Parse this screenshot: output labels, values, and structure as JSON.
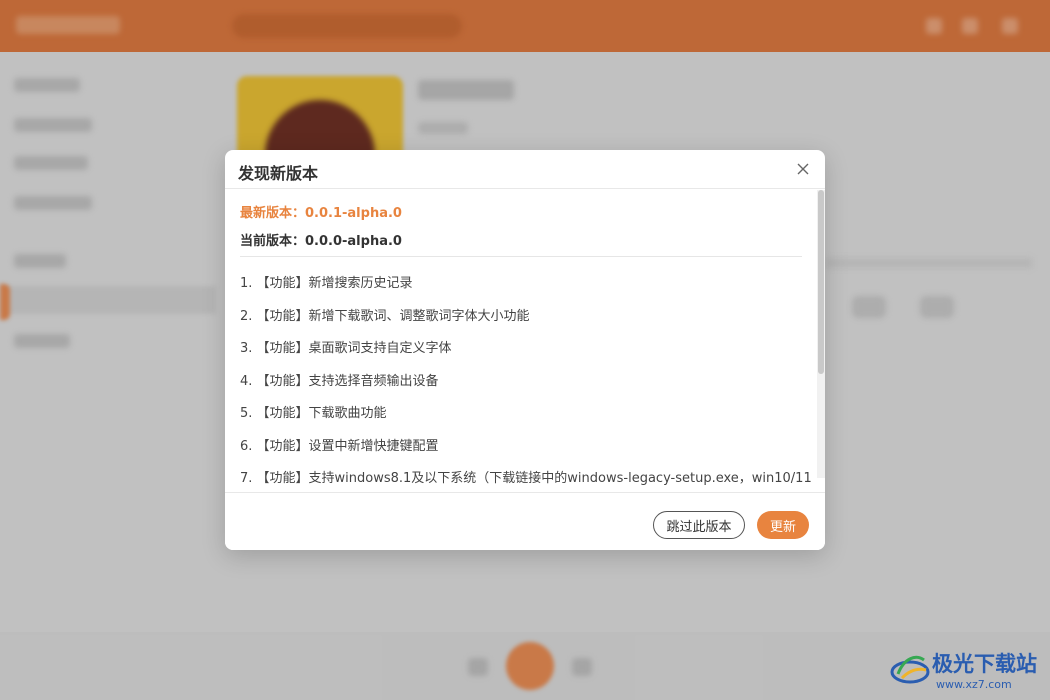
{
  "dialog": {
    "title": "发现新版本",
    "latest_version": "最新版本：0.0.1-alpha.0",
    "current_version": "当前版本：0.0.0-alpha.0",
    "changelog": [
      "1. 【功能】新增搜索历史记录",
      "2. 【功能】新增下载歌词、调整歌词字体大小功能",
      "3. 【功能】桌面歌词支持自定义字体",
      "4. 【功能】支持选择音频输出设备",
      "5. 【功能】下载歌曲功能",
      "6. 【功能】设置中新增快捷键配置",
      "7. 【功能】支持windows8.1及以下系统（下载链接中的windows-legacy-setup.exe，win10/11"
    ],
    "skip_label": "跳过此版本",
    "update_label": "更新"
  },
  "watermark": {
    "name": "极光下载站",
    "url": "www.xz7.com"
  },
  "colors": {
    "accent": "#e8843f",
    "topbar": "#d9773f",
    "watermark": "#2a5db0"
  },
  "icons": {
    "close": "close-icon",
    "watermark_logo": "aurora-logo"
  }
}
